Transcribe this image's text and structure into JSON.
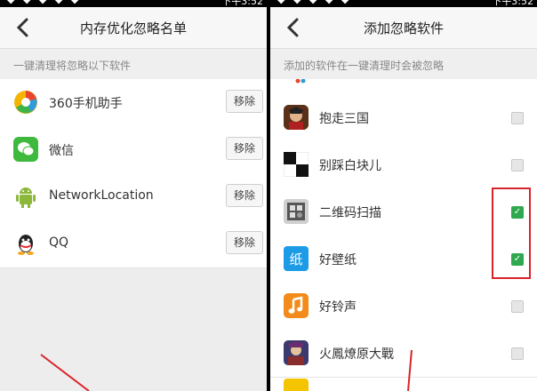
{
  "status_bar": {
    "time": "下午3:52"
  },
  "left": {
    "title": "内存优化忽略名单",
    "section": "一键清理将忽略以下软件",
    "items": [
      {
        "label": "360手机助手",
        "icon": "360-assistant-icon",
        "button": "移除"
      },
      {
        "label": "微信",
        "icon": "wechat-icon",
        "button": "移除"
      },
      {
        "label": "NetworkLocation",
        "icon": "android-icon",
        "button": "移除"
      },
      {
        "label": "QQ",
        "icon": "qq-icon",
        "button": "移除"
      }
    ]
  },
  "right": {
    "title": "添加忽略软件",
    "section": "添加的软件在一键清理时会被忽略",
    "items": [
      {
        "label": "抱走三国",
        "icon": "game-icon",
        "checked": false
      },
      {
        "label": "别踩白块儿",
        "icon": "piano-tiles-icon",
        "checked": false
      },
      {
        "label": "二维码扫描",
        "icon": "qr-scanner-icon",
        "checked": true
      },
      {
        "label": "好壁纸",
        "icon": "wallpaper-icon",
        "checked": true
      },
      {
        "label": "好铃声",
        "icon": "ringtone-icon",
        "checked": false
      },
      {
        "label": "火鳳燎原大戰",
        "icon": "game-icon",
        "checked": false
      }
    ]
  },
  "colors": {
    "accent_green": "#2fa84f",
    "highlight_red": "#d9232a"
  }
}
